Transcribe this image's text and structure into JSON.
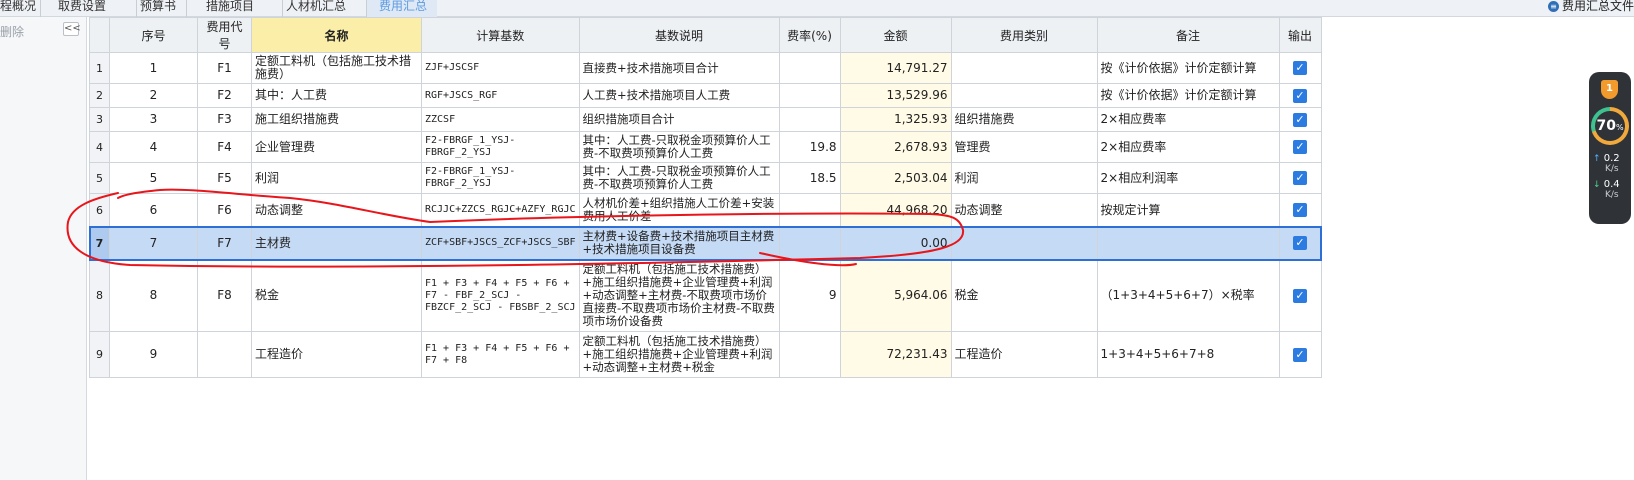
{
  "tabs": [
    {
      "label": "程概况",
      "active": false
    },
    {
      "label": "取费设置",
      "active": false
    },
    {
      "label": "预算书",
      "active": false
    },
    {
      "label": "措施项目",
      "active": false
    },
    {
      "label": "人材机汇总",
      "active": false
    },
    {
      "label": "费用汇总",
      "active": true
    }
  ],
  "top_right": {
    "icon": "document-icon",
    "label": "费用汇总文件"
  },
  "left_panel": {
    "delete_label": "删除",
    "collapse_glyph": "<<"
  },
  "columns": [
    "序号",
    "费用代号",
    "名称",
    "计算基数",
    "基数说明",
    "费率(%)",
    "金额",
    "费用类别",
    "备注",
    "输出"
  ],
  "rows": [
    {
      "rownum": "1",
      "seq": "1",
      "code": "F1",
      "name": "定额工料机（包括施工技术措施费）",
      "base": "ZJF+JSCSF",
      "desc": "直接费+技术措施项目合计",
      "rate": "",
      "amount": "14,791.27",
      "category": "",
      "remark": "按《计价依据》计价定额计算",
      "output": true,
      "selected": false
    },
    {
      "rownum": "2",
      "seq": "2",
      "code": "F2",
      "name": "其中：人工费",
      "base": "RGF+JSCS_RGF",
      "desc": "人工费+技术措施项目人工费",
      "rate": "",
      "amount": "13,529.96",
      "category": "",
      "remark": "按《计价依据》计价定额计算",
      "output": true,
      "selected": false
    },
    {
      "rownum": "3",
      "seq": "3",
      "code": "F3",
      "name": "施工组织措施费",
      "base": "ZZCSF",
      "desc": "组织措施项目合计",
      "rate": "",
      "amount": "1,325.93",
      "category": "组织措施费",
      "remark": "2×相应费率",
      "output": true,
      "selected": false
    },
    {
      "rownum": "4",
      "seq": "4",
      "code": "F4",
      "name": "企业管理费",
      "base": "F2-FBRGF_1_YSJ-FBRGF_2_YSJ",
      "desc": "其中：人工费-只取税金项预算价人工费-不取费项预算价人工费",
      "rate": "19.8",
      "amount": "2,678.93",
      "category": "管理费",
      "remark": "2×相应费率",
      "output": true,
      "selected": false
    },
    {
      "rownum": "5",
      "seq": "5",
      "code": "F5",
      "name": "利润",
      "base": "F2-FBRGF_1_YSJ-FBRGF_2_YSJ",
      "desc": "其中：人工费-只取税金项预算价人工费-不取费项预算价人工费",
      "rate": "18.5",
      "amount": "2,503.04",
      "category": "利润",
      "remark": "2×相应利润率",
      "output": true,
      "selected": false
    },
    {
      "rownum": "6",
      "seq": "6",
      "code": "F6",
      "name": "动态调整",
      "base": "RCJJC+ZZCS_RGJC+AZFY_RGJC",
      "desc": "人材机价差+组织措施人工价差+安装费用人工价差",
      "rate": "",
      "amount": "44,968.20",
      "category": "动态调整",
      "remark": "按规定计算",
      "output": true,
      "selected": false
    },
    {
      "rownum": "7",
      "seq": "7",
      "code": "F7",
      "name": "主材费",
      "base": "ZCF+SBF+JSCS_ZCF+JSCS_SBF",
      "desc": "主材费+设备费+技术措施项目主材费+技术措施项目设备费",
      "rate": "",
      "amount": "0.00",
      "category": "",
      "remark": "",
      "output": true,
      "selected": true
    },
    {
      "rownum": "8",
      "seq": "8",
      "code": "F8",
      "name": "税金",
      "base": "F1 + F3 + F4 + F5 + F6 + F7 - FBF_2_SCJ - FBZCF_2_SCJ - FBSBF_2_SCJ",
      "desc": "定额工料机（包括施工技术措施费）+施工组织措施费+企业管理费+利润+动态调整+主材费-不取费项市场价直接费-不取费项市场价主材费-不取费项市场价设备费",
      "rate": "9",
      "amount": "5,964.06",
      "category": "税金",
      "remark": "（1+3+4+5+6+7）×税率",
      "output": true,
      "selected": false
    },
    {
      "rownum": "9",
      "seq": "9",
      "code": "",
      "name": "工程造价",
      "base": "F1 + F3 + F4 + F5 + F6 + F7 + F8",
      "desc": "定额工料机（包括施工技术措施费）+施工组织措施费+企业管理费+利润+动态调整+主材费+税金",
      "rate": "",
      "amount": "72,231.43",
      "category": "工程造价",
      "remark": "1+3+4+5+6+7+8",
      "output": true,
      "selected": false
    }
  ],
  "widget": {
    "badge": "1",
    "percent": "70",
    "percent_unit": "%",
    "up_speed": "0.2",
    "up_unit": "K/s",
    "down_speed": "0.4",
    "down_unit": "K/s"
  },
  "colors": {
    "accent": "#2b7be0",
    "selection": "#c4daf5",
    "annotation": "#e8151b",
    "amount_bg": "#fffbe6"
  }
}
